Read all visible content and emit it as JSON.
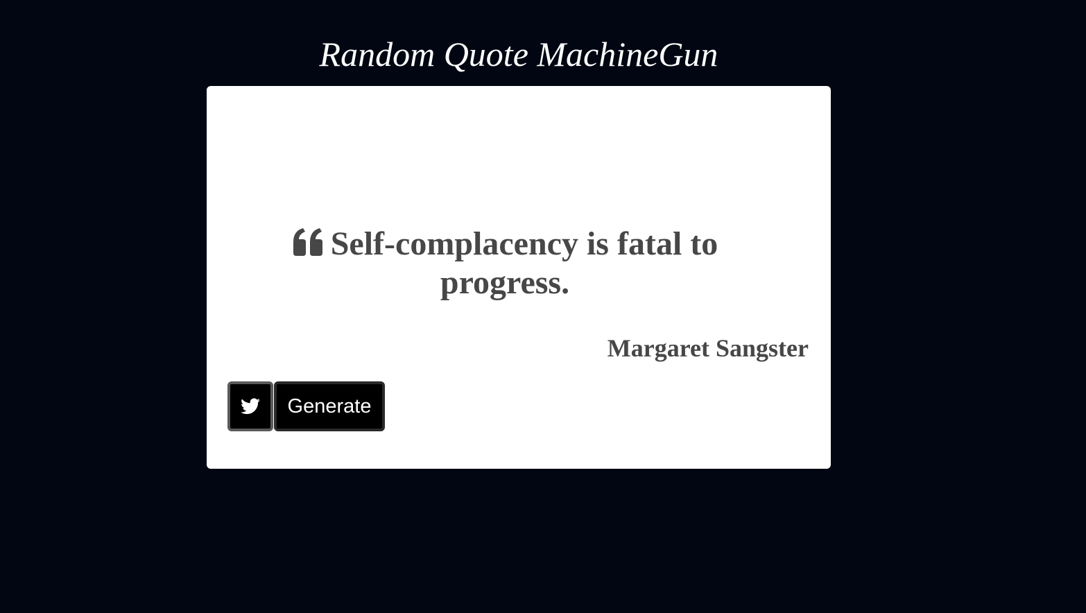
{
  "page": {
    "title": "Random Quote MachineGun"
  },
  "quote": {
    "text": "Self-complacency is fatal to progress.",
    "author": "Margaret Sangster",
    "icon": "quote-left-icon"
  },
  "actions": {
    "tweet_icon": "twitter-icon",
    "generate_label": "Generate"
  },
  "colors": {
    "background": "#020612",
    "card": "#ffffff",
    "quote_text": "#474747",
    "button_bg": "#000000",
    "button_text": "#ffffff"
  }
}
